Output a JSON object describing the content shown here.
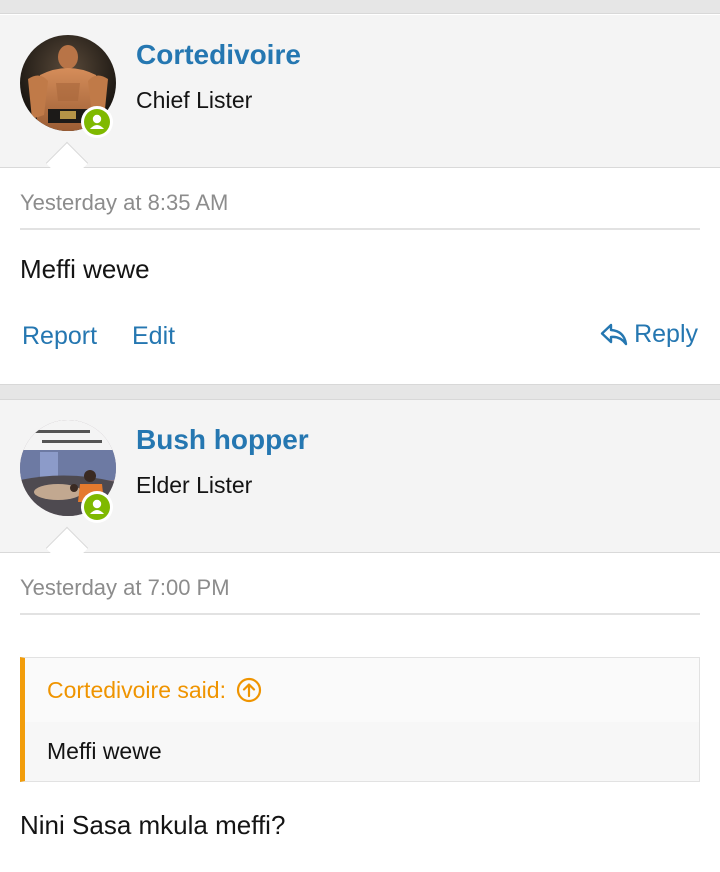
{
  "posts": [
    {
      "username": "Cortedivoire",
      "user_title": "Chief Lister",
      "timestamp": "Yesterday at 8:35 AM",
      "message": "Meffi wewe",
      "actions": {
        "report": "Report",
        "edit": "Edit",
        "reply": "Reply"
      }
    },
    {
      "username": "Bush hopper",
      "user_title": "Elder Lister",
      "timestamp": "Yesterday at 7:00 PM",
      "quote": {
        "author_label": "Cortedivoire said:",
        "text": "Meffi wewe"
      },
      "message": "Nini Sasa mkula meffi?"
    }
  ],
  "colors": {
    "link": "#2577b1",
    "online": "#7fb900",
    "quote_accent": "#f29d0b"
  },
  "icons": {
    "online": "user-online-icon",
    "reply": "reply-arrow-icon",
    "quote_jump": "circle-arrow-up-icon"
  }
}
